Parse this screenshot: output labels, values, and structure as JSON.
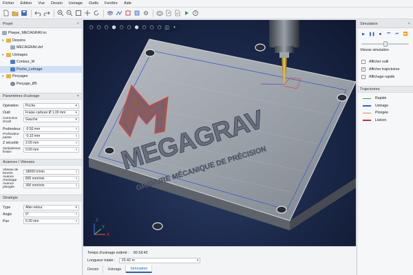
{
  "menu": [
    "Fichier",
    "Edition",
    "Vue",
    "Dessin",
    "Usinage",
    "Outils",
    "Fenêtre",
    "Aide"
  ],
  "toolbar_icons": [
    "new-file-icon",
    "open-icon",
    "save-icon",
    "undo-icon",
    "redo-icon",
    "zoom-in-icon",
    "zoom-out-icon",
    "zoom-fit-icon",
    "pan-icon",
    "rotate-icon",
    "layers-icon",
    "toolpath-icon",
    "contour-icon",
    "pocket-icon",
    "drill-icon",
    "stock-icon",
    "export-icon",
    "post-icon",
    "simulate-icon",
    "help-icon"
  ],
  "project": {
    "title": "Projet",
    "file": "Plaque_MECAGRAV.nc",
    "groups": [
      {
        "label": "Dessins",
        "items": [
          "MECAGRAV.dxf"
        ]
      },
      {
        "label": "Usinages",
        "items": [
          "Contour_M",
          "Poche_Lettrage"
        ]
      },
      {
        "label": "Perçages",
        "items": [
          "Perçage_Ø5"
        ]
      }
    ]
  },
  "params": {
    "title": "Paramètres d'usinage",
    "rows": [
      {
        "label": "Opération",
        "value": "Poche"
      },
      {
        "label": "Outil",
        "value": "Fraise carbure Ø 1.00 mm"
      },
      {
        "label": "Correction d'outil",
        "value": "Gauche"
      },
      {
        "label": "Profondeur",
        "value": "-0.50 mm"
      },
      {
        "label": "Profondeur passe",
        "value": "-0.10 mm"
      },
      {
        "label": "Z sécurité",
        "value": "2.00 mm"
      },
      {
        "label": "Surépaisseur finition",
        "value": "0.00 mm"
      }
    ]
  },
  "speeds": {
    "title": "Avances / Vitesses",
    "rows": [
      {
        "label": "Vitesse de broche",
        "value": "18000 tr/min"
      },
      {
        "label": "Avance d'usinage",
        "value": "800 mm/min"
      },
      {
        "label": "Avance plongée",
        "value": "300 mm/min"
      }
    ]
  },
  "strategy": {
    "title": "Stratégie",
    "rows": [
      {
        "label": "Type",
        "value": "Aller-retour"
      },
      {
        "label": "Angle",
        "value": "0°"
      },
      {
        "label": "Pas",
        "value": "0.30 mm"
      }
    ]
  },
  "viewport": {
    "brand": "MEGAGRAV",
    "tagline": "GRAVURE MÉCANIQUE DE PRÉCISION",
    "axes": {
      "x": "X",
      "y": "Y",
      "z": "Z"
    }
  },
  "bottom": {
    "time_label": "Temps d'usinage estimé :",
    "time_value": "00:18:42",
    "length_label": "Longueur totale :",
    "length_value": "15.42 m",
    "tabs": [
      "Dessin",
      "Usinage",
      "Simulation"
    ],
    "active_tab": "Simulation"
  },
  "simulation": {
    "title": "Simulation",
    "speed_label": "Vitesse simulation",
    "speed_fraction": 0.5,
    "checks": [
      {
        "label": "Afficher outil",
        "checked": false
      },
      {
        "label": "Afficher trajectoires",
        "checked": true
      },
      {
        "label": "Affichage rapide",
        "checked": false
      }
    ]
  },
  "trajectories": {
    "title": "Trajectoires",
    "items": [
      {
        "label": "Rapide",
        "color": "#2aa34a"
      },
      {
        "label": "Usinage",
        "color": "#2f5fd0"
      },
      {
        "label": "Plongée",
        "color": "#e08a2a"
      },
      {
        "label": "Liaison",
        "color": "#c8313b"
      }
    ]
  }
}
